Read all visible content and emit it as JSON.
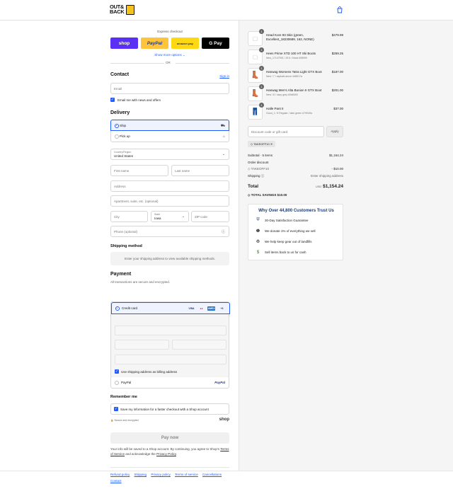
{
  "header": {
    "logo_line1": "OUT&",
    "logo_line2": "BACK",
    "bag_icon": "shopping-bag-icon"
  },
  "express": {
    "label": "Express checkout",
    "buttons": [
      {
        "label": "shop",
        "bg": "#5a31f4",
        "color": "#ffffff"
      },
      {
        "label": "PayPal",
        "bg": "#ffc439",
        "color": "#253b80"
      },
      {
        "label": "amazon pay",
        "bg": "#ffd814",
        "color": "#333333"
      },
      {
        "label": "G Pay",
        "bg": "#000000",
        "color": "#ffffff"
      }
    ],
    "more": "Show more options ⌄",
    "or": "OR"
  },
  "contact": {
    "title": "Contact",
    "signin": "Sign in",
    "email_placeholder": "Email",
    "news_label": "Email me with news and offers"
  },
  "delivery": {
    "title": "Delivery",
    "ship": "Ship",
    "pickup": "Pick up",
    "country_label": "Country/Region",
    "country_value": "United States",
    "first_name": "First name",
    "last_name": "Last name",
    "address": "Address",
    "apartment": "Apartment, suite, etc. (optional)",
    "city": "City",
    "state_label": "State",
    "state_value": "Iowa",
    "zip": "ZIP code",
    "phone": "Phone (optional)"
  },
  "shipping_method": {
    "title": "Shipping method",
    "placeholder": "Enter your shipping address to view available shipping methods."
  },
  "payment": {
    "title": "Payment",
    "subtitle": "All transactions are secure and encrypted.",
    "credit_card": "Credit card",
    "card_logos": [
      "VISA",
      "MC",
      "AMEX",
      "+3"
    ],
    "billing_label": "Use shipping address as billing address",
    "paypal": "PayPal",
    "paypal_logo": "PayPal"
  },
  "remember": {
    "title": "Remember me",
    "save_label": "Save my information for a faster checkout with a Shop account",
    "secure": "Secure and encrypted",
    "shop_logo": "shop"
  },
  "pay_now": "Pay now",
  "legal": {
    "text": "Your info will be saved to a Shop account. By continuing, you agree to Shop's",
    "terms": "Terms of Service",
    "and": "and acknowledge the",
    "privacy": "Privacy Policy",
    "end": "."
  },
  "footer_links": [
    "Refund policy",
    "Shipping",
    "Privacy policy",
    "Terms of service",
    "Cancellations",
    "Contact"
  ],
  "cart": {
    "items": [
      {
        "qty": "1",
        "name": "Head Kore 93 Skis (green, Excellent_18230689, 162, NONE)",
        "variant": "",
        "price": "$479.99"
      },
      {
        "qty": "1",
        "name": "Hees Prime XTD 100 HT Ski Boots",
        "variant": "New_17147991 / 29.5 / black #08999",
        "price": "$259.25"
      },
      {
        "qty": "1",
        "name": "Hanwag Womens Tatra Light GTX Boot",
        "variant": "New / 7 / asphalt-armor #48517a",
        "price": "$187.00"
      },
      {
        "qty": "1",
        "name": "Hanwag Men's Alta Bunion II GTX Boot",
        "variant": "New / 8 / navy grey #0b8493",
        "price": "$201.00"
      },
      {
        "qty": "1",
        "name": "Halle Pant II",
        "variant": "Good_1 / 8 Regular / dark green #79949a",
        "price": "$37.00"
      }
    ],
    "discount_placeholder": "Discount code or gift card",
    "apply": "Apply",
    "code_tag": "TAKEOFF10",
    "subtotal_label": "Subtotal · 5 items",
    "subtotal": "$1,164.24",
    "order_discount": "Order discount",
    "discount_code": "TAKEOFF10",
    "discount_amount": "- $10.00",
    "shipping_label": "Shipping",
    "shipping_value": "Enter shipping address",
    "total_label": "Total",
    "currency": "USD",
    "total": "$1,154.24",
    "savings": "TOTAL SAVINGS  $10.00"
  },
  "trust": {
    "title": "Why Over 44,800 Customers Trust Us",
    "rows": [
      {
        "icon": "shield-icon",
        "text": "30-Day Satisfaction Guarantee"
      },
      {
        "icon": "one-percent-icon",
        "text": "We donate 1% of everything we sell"
      },
      {
        "icon": "recycle-icon",
        "text": "We help keep gear out of landfills"
      },
      {
        "icon": "cash-icon",
        "text": "Sell items back to us for cash"
      }
    ]
  }
}
